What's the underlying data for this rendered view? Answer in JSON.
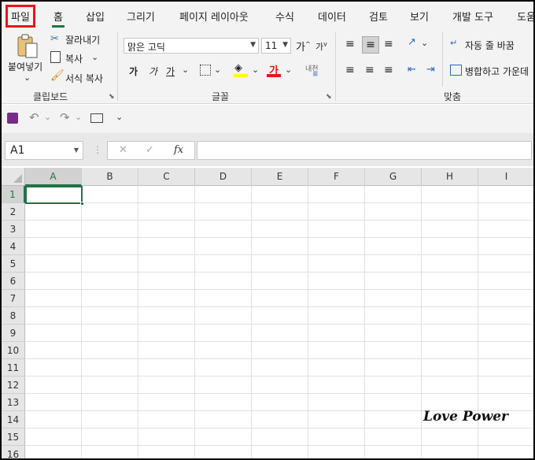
{
  "menu": {
    "tabs": [
      {
        "label": "파일",
        "highlight": true
      },
      {
        "label": "홈",
        "active": true
      },
      {
        "label": "삽입"
      },
      {
        "label": "그리기"
      },
      {
        "label": "페이지 레이아웃"
      },
      {
        "label": "수식"
      },
      {
        "label": "데이터"
      },
      {
        "label": "검토"
      },
      {
        "label": "보기"
      },
      {
        "label": "개발 도구"
      },
      {
        "label": "도움"
      }
    ]
  },
  "ribbon": {
    "clipboard": {
      "paste_label": "붙여넣기",
      "cut_label": "잘라내기",
      "copy_label": "복사",
      "format_painter_label": "서식 복사",
      "group_label": "클립보드"
    },
    "font": {
      "font_name": "맑은 고딕",
      "font_size": "11",
      "grow_label": "가",
      "shrink_label": "가",
      "bold_label": "가",
      "italic_label": "가",
      "underline_label": "가",
      "font_color_label": "가",
      "phonetic_label": "내천",
      "group_label": "글꼴",
      "fill_color": "#ffff00",
      "font_color": "#e8141a"
    },
    "alignment": {
      "wrap_label": "자동 줄 바꿈",
      "merge_label": "병합하고 가운데",
      "group_label": "맞춤"
    }
  },
  "formula_bar": {
    "name_box": "A1",
    "cancel_icon": "✕",
    "enter_icon": "✓",
    "fx_label": "fx",
    "formula": ""
  },
  "sheet": {
    "columns": [
      "A",
      "B",
      "C",
      "D",
      "E",
      "F",
      "G",
      "H",
      "I"
    ],
    "rows": [
      "1",
      "2",
      "3",
      "4",
      "5",
      "6",
      "7",
      "8",
      "9",
      "10",
      "11",
      "12",
      "13",
      "14",
      "15",
      "16"
    ],
    "active_cell": "A1"
  },
  "watermark": "Love Power",
  "colors": {
    "accent": "#217346",
    "highlight_box": "#e8141a",
    "save_icon": "#7a2c8a"
  }
}
